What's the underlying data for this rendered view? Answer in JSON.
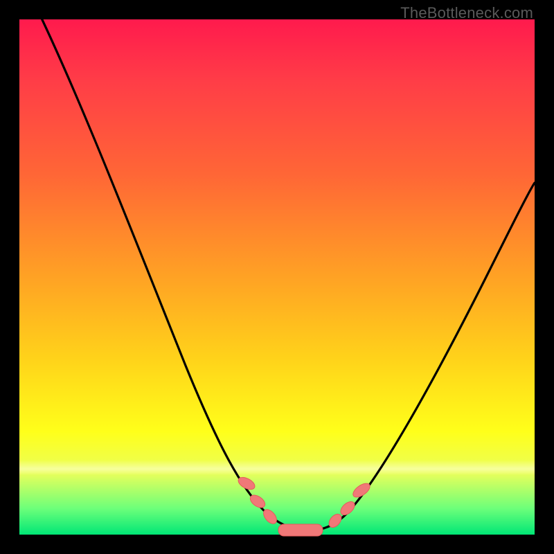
{
  "attribution": "TheBottleneck.com",
  "colors": {
    "frame": "#000000",
    "curve": "#000000",
    "marker_fill": "#f07878",
    "marker_stroke": "#e65a5a",
    "gradient_stops": [
      "#ff1a4d",
      "#ff3d47",
      "#ff6636",
      "#ffa224",
      "#ffd31a",
      "#ffff1a",
      "#eaff5a",
      "#6bff7a",
      "#00e676"
    ]
  },
  "chart_data": {
    "type": "line",
    "title": "",
    "xlabel": "",
    "ylabel": "",
    "xlim": [
      0,
      100
    ],
    "ylim": [
      0,
      100
    ],
    "x": [
      0,
      5,
      10,
      15,
      20,
      25,
      30,
      35,
      40,
      42,
      45,
      48,
      50,
      52,
      55,
      58,
      60,
      65,
      70,
      75,
      80,
      85,
      90,
      95,
      100
    ],
    "values": [
      100,
      88,
      76,
      64,
      53,
      42,
      32,
      23,
      14,
      11,
      7,
      3,
      1,
      0,
      0,
      1,
      3,
      8,
      15,
      23,
      31,
      40,
      49,
      58,
      67
    ],
    "markers": [
      {
        "x": 44,
        "y": 8
      },
      {
        "x": 46,
        "y": 5
      },
      {
        "x": 48,
        "y": 2
      },
      {
        "x": 50,
        "y": 0.5
      },
      {
        "x": 53,
        "y": 0
      },
      {
        "x": 56,
        "y": 0.5
      },
      {
        "x": 59,
        "y": 2.5
      },
      {
        "x": 61,
        "y": 5
      },
      {
        "x": 63,
        "y": 8
      }
    ],
    "note": "V-shaped bottleneck curve over a red→green heatmap gradient; minimum near x≈53."
  }
}
